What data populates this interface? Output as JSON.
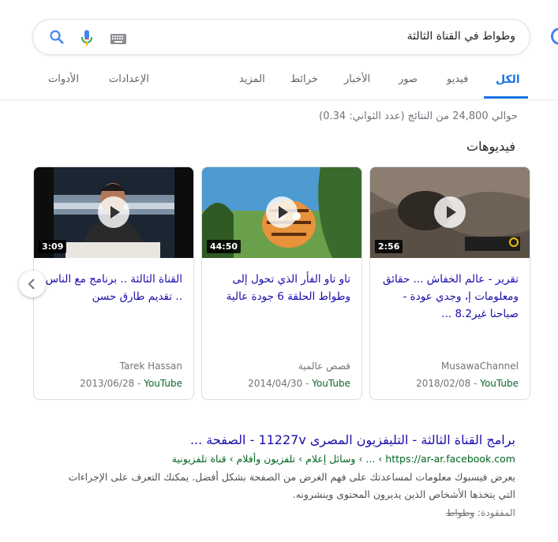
{
  "search": {
    "query": "وطواط في القناة الثالثة"
  },
  "tabs": {
    "all": "الكل",
    "videos": "فيديو",
    "images": "صور",
    "news": "الأخبار",
    "maps": "خرائط",
    "more": "المزيد",
    "settings": "الإعدادات",
    "tools": "الأدوات"
  },
  "stats": "حوالي 24,800 من النتائج (عدد الثواني: 0.34)",
  "videos_heading": "فيديوهات",
  "videos": [
    {
      "duration": "2:56",
      "title": "تقرير - عالم الخفاش ... حقائق ومعلومات إ، وجدي عودة - صباحنا غير8.2 ...",
      "source": "MusawaChannel",
      "date": "2018/02/08",
      "platform": "YouTube"
    },
    {
      "duration": "44:50",
      "title": "تاو تاو الفأر الذي تحول إلى وطواط الحلقة 6 جودة عالية",
      "source": "قصص عالمية",
      "date": "2014/04/30",
      "platform": "YouTube"
    },
    {
      "duration": "3:09",
      "title": "القناة الثالثة .. برنامج مع الناس .. تقديم طارق حسن",
      "source": "Tarek Hassan",
      "date": "2013/06/28",
      "platform": "YouTube"
    }
  ],
  "result": {
    "title": "برامج القناة الثالثة - التليفزيون المصرى 11227v - الصفحة ...",
    "url": "https://ar-ar.facebook.com › ... › وسائل إعلام › تلفزيون وأفلام › قناة تلفزيونية",
    "snippet": "يعرض فيسبوك معلومات لمساعدتك على فهم الغرض من الصفحة بشكل أفضل. يمكنك التعرف على الإجراءات التي يتخذها الأشخاص الذين يديرون المحتوى وينشرونه.",
    "missing_label": "المفقودة:",
    "missing_term": "وطواط"
  }
}
